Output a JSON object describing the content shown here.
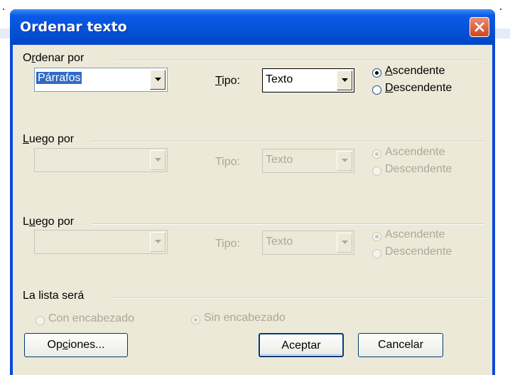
{
  "window": {
    "title": "Ordenar texto",
    "close_icon": "close-icon"
  },
  "groups": [
    {
      "label_pre": "O",
      "label_u": "r",
      "label_post": "denar por",
      "field_value": "Párrafos",
      "tipo_u": "T",
      "tipo_post": "ipo:",
      "tipo_value": "Texto",
      "asc_u": "A",
      "asc_post": "scendente",
      "desc_u": "D",
      "desc_post": "escendente",
      "enabled": true,
      "selected": "asc"
    },
    {
      "label_pre": "",
      "label_u": "L",
      "label_post": "uego por",
      "field_value": "",
      "tipo_label": "Tipo:",
      "tipo_value": "Texto",
      "asc_label": "Ascendente",
      "desc_label": "Descendente",
      "enabled": false,
      "selected": "asc"
    },
    {
      "label_pre": "L",
      "label_u": "u",
      "label_post": "ego por",
      "field_value": "",
      "tipo_label": "Tipo:",
      "tipo_value": "Texto",
      "asc_label": "Ascendente",
      "desc_label": "Descendente",
      "enabled": false,
      "selected": "asc"
    }
  ],
  "list": {
    "label": "La lista será",
    "option_header": "Con encabezado",
    "option_no_header": "Sin encabezado",
    "selected": "no_header"
  },
  "buttons": {
    "options_pre": "Op",
    "options_u": "c",
    "options_post": "iones...",
    "accept": "Aceptar",
    "cancel": "Cancelar"
  }
}
